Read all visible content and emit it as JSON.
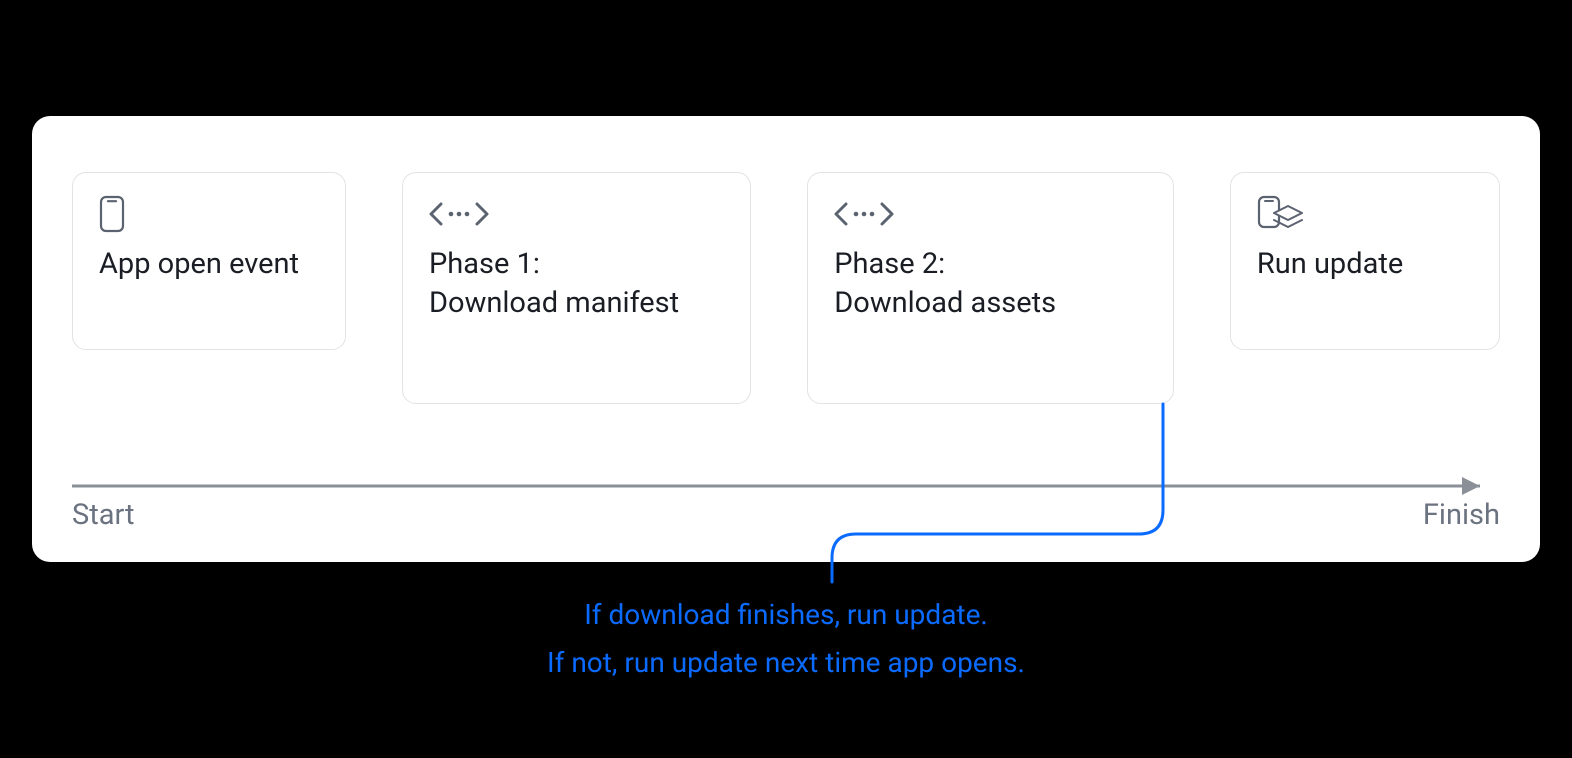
{
  "timeline": {
    "start_label": "Start",
    "finish_label": "Finish"
  },
  "cards": [
    {
      "icon": "phone",
      "text": "App open event"
    },
    {
      "icon": "code-dots",
      "text": "Phase 1:\nDownload manifest"
    },
    {
      "icon": "code-dots",
      "text": "Phase 2:\nDownload assets"
    },
    {
      "icon": "phone-layers",
      "text": "Run update"
    }
  ],
  "annotation": {
    "line1": "If download finishes, run update.",
    "line2": "If not, run update next time app opens."
  },
  "colors": {
    "annotation": "#0b6bff",
    "muted": "#6b7280",
    "border": "#e2e3e6",
    "text": "#1a1e24",
    "arrow": "#8a8f98"
  }
}
